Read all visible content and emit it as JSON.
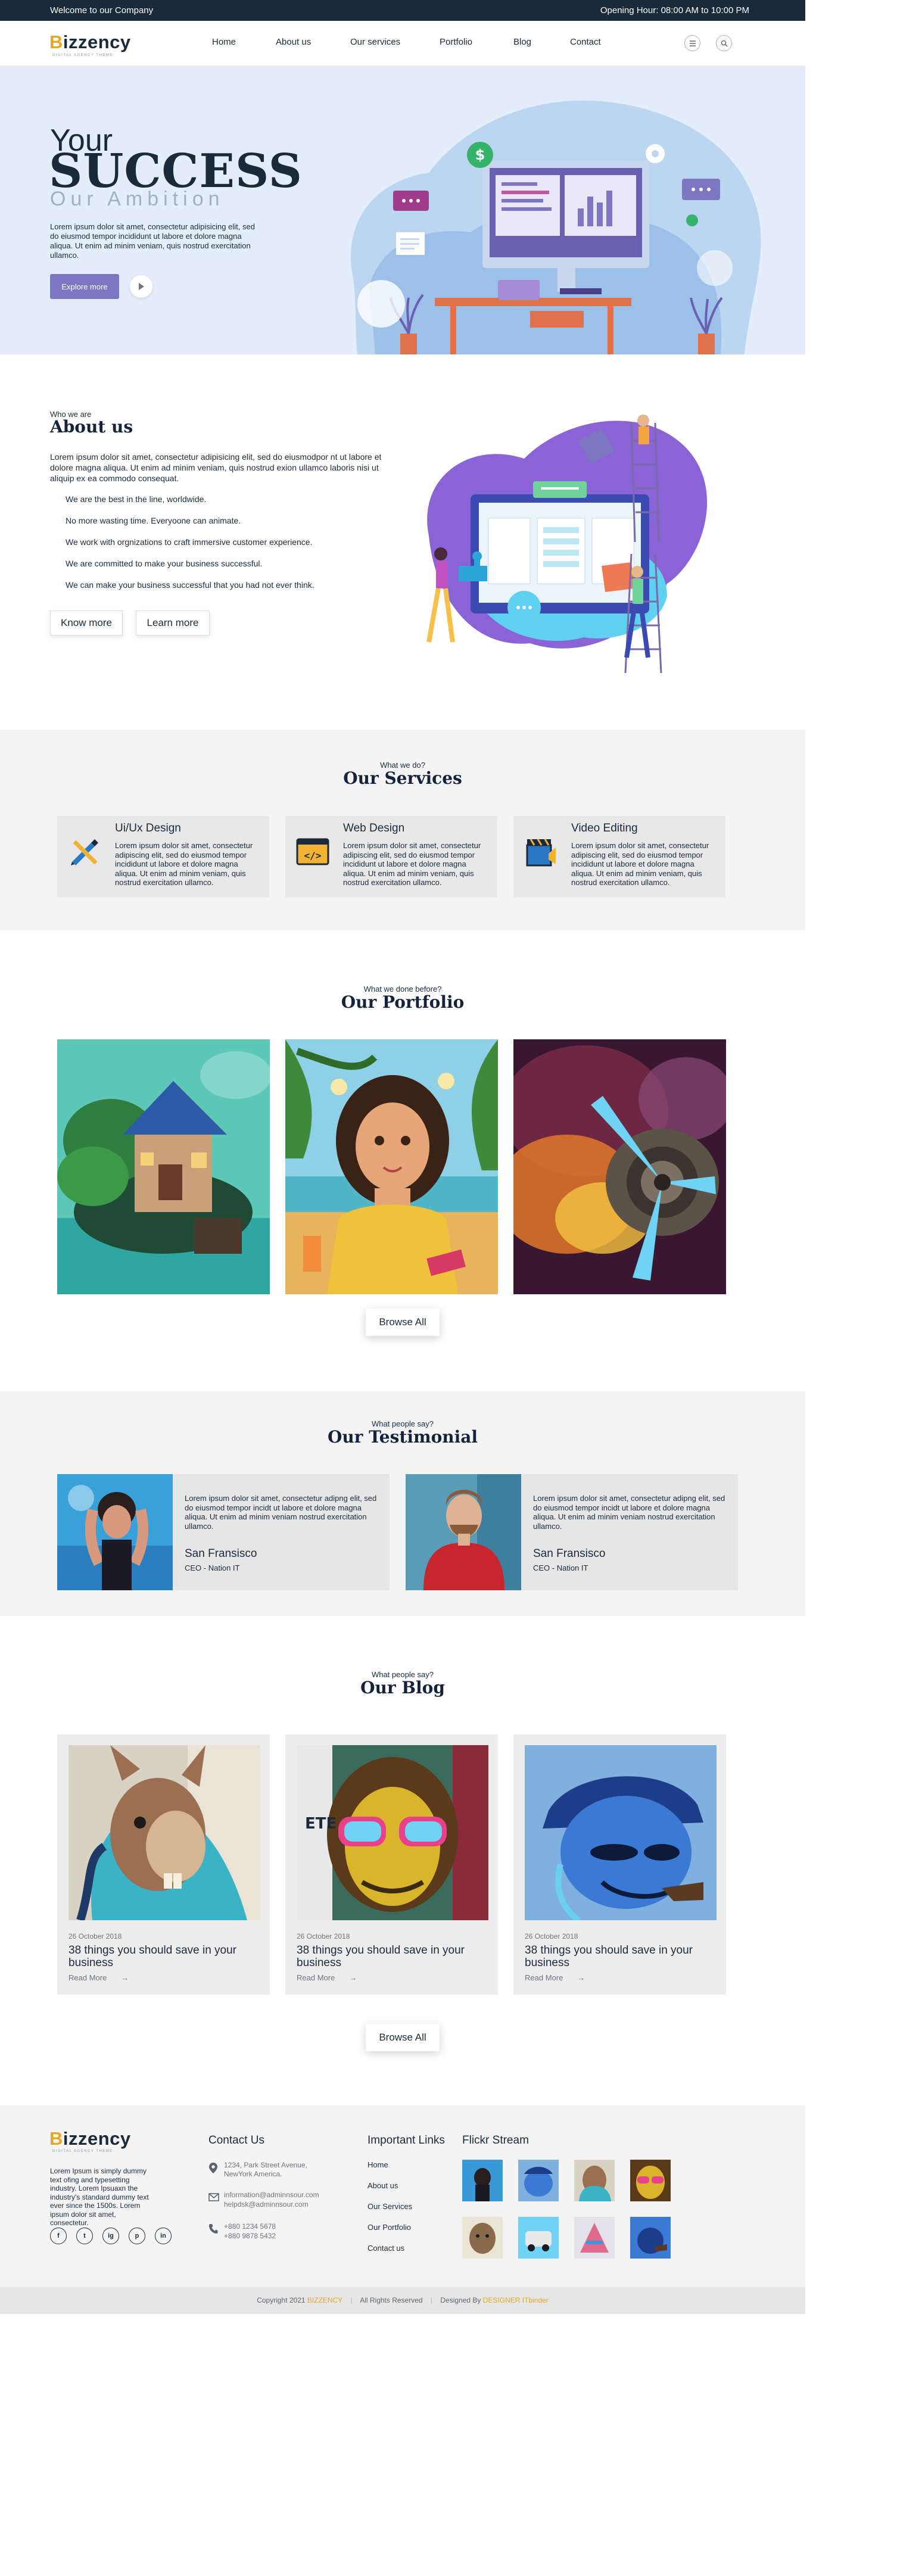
{
  "topbar": {
    "welcome": "Welcome to our Company",
    "hours": "Opening Hour: 08:00 AM to 10:00 PM"
  },
  "brand": {
    "name_first": "B",
    "name_rest": "izzency",
    "tagline": "DIGITAL AGENCY THEME",
    "accent": "#e2a923",
    "dark": "#1b2a3b",
    "purple": "#7d77c2"
  },
  "nav": {
    "items": [
      "Home",
      "About us",
      "Our services",
      "Portfolio",
      "Blog",
      "Contact"
    ],
    "menu_icon": "menu-icon",
    "search_icon": "search-icon"
  },
  "hero": {
    "your": "Your",
    "success": "SUCCESS",
    "ambition": "Our Ambition",
    "desc": "Lorem ipsum dolor sit amet, consectetur adipisicing elit, sed do eiusmod tempor incididunt ut labore et dolore magna aliqua. Ut enim ad minim veniam, quis nostrud exercitation ullamco.",
    "cta": "Explore more",
    "play_icon": "play-icon"
  },
  "about": {
    "kicker": "Who we are",
    "title": "About us",
    "desc": "Lorem ipsum dolor sit amet, consectetur adipisicing elit, sed do eiusmodpor nt ut labore et dolore magna aliqua. Ut enim ad minim veniam, quis nostrud exion ullamco laboris nisi ut aliquip ex ea commodo consequat.",
    "points": [
      "We are the best in the line, worldwide.",
      "No more wasting time. Everyoone can animate.",
      "We work with orgnizations to craft immersive customer experience.",
      "We are committed to make your business successful.",
      "We can make your business successful that you had not ever think."
    ],
    "btn_know": "Know more",
    "btn_learn": "Learn more"
  },
  "services": {
    "kicker": "What we do?",
    "title": "Our Services",
    "cards": [
      {
        "title": "Ui/Ux Design",
        "text": "Lorem ipsum dolor sit amet, consectetur adipiscing elit, sed do eiusmod tempor incididunt ut labore et dolore magna aliqua. Ut enim ad minim veniam, quis nostrud exercitation ullamco.",
        "icon": "design-tools-icon"
      },
      {
        "title": "Web Design",
        "text": "Lorem ipsum dolor sit amet, consectetur adipiscing elit, sed do eiusmod tempor incididunt ut labore et dolore magna aliqua. Ut enim ad minim veniam, quis nostrud exercitation ullamco.",
        "icon": "code-window-icon"
      },
      {
        "title": "Video Editing",
        "text": "Lorem ipsum dolor sit amet, consectetur adipiscing elit, sed do eiusmod tempor incididunt ut labore et dolore magna aliqua. Ut enim ad minim veniam, quis nostrud exercitation ullamco.",
        "icon": "clapperboard-icon"
      }
    ]
  },
  "portfolio": {
    "kicker": "What we done before?",
    "title": "Our Portfolio",
    "browse": "Browse All"
  },
  "testimonial": {
    "kicker": "What people say?",
    "title": "Our Testimonial",
    "items": [
      {
        "text": "Lorem ipsum dolor sit amet, consectetur adipng elit, sed do eiusmod tempor incidt ut labore et dolore magna aliqua. Ut enim ad minim veniam nostrud exercitation ullamco.",
        "name": "San Fransisco",
        "role": "CEO - Nation IT"
      },
      {
        "text": "Lorem ipsum dolor sit amet, consectetur adipng elit, sed do eiusmod tempor incidt ut labore et dolore magna aliqua. Ut enim ad minim veniam nostrud exercitation ullamco.",
        "name": "San Fransisco",
        "role": "CEO - Nation IT"
      }
    ]
  },
  "blog": {
    "kicker": "What people say?",
    "title": "Our Blog",
    "posts": [
      {
        "date": "26 October 2018",
        "title": "38 things you should save in your business",
        "read": "Read More"
      },
      {
        "date": "26 October 2018",
        "title": "38 things you should save in your business",
        "read": "Read More"
      },
      {
        "date": "26 October 2018",
        "title": "38 things you should save in your business",
        "read": "Read More"
      }
    ],
    "browse": "Browse All"
  },
  "footer": {
    "about": "Lorem Ipsum is simply dummy text ofing and typesetting industry. Lorem Ipsuaxn the industry's standard dummy text ever since the 1500s. Lorem ipsum dolor sit amet, consectetur.",
    "social": [
      "f",
      "t",
      "ig",
      "p",
      "in"
    ],
    "contact_title": "Contact Us",
    "address": "1234, Park Street Avenue, NewYork America.",
    "email1": "information@adminnsour.com",
    "email2": "helpdsk@adminnsour.com",
    "phone1": "+880 1234 5678",
    "phone2": "+880 9878 5432",
    "links_title": "Important Links",
    "links": [
      "Home",
      "About us",
      "Our Services",
      "Our Portfolio",
      "Contact us"
    ],
    "flickr_title": "Flickr Stream",
    "copy_pre": "Copyright 2021",
    "copy_brand": "BIZZENCY",
    "copy_rights": "All Rights Reserved",
    "copy_designed": "Designed By",
    "copy_designer": "DESIGNER ITbinder"
  }
}
